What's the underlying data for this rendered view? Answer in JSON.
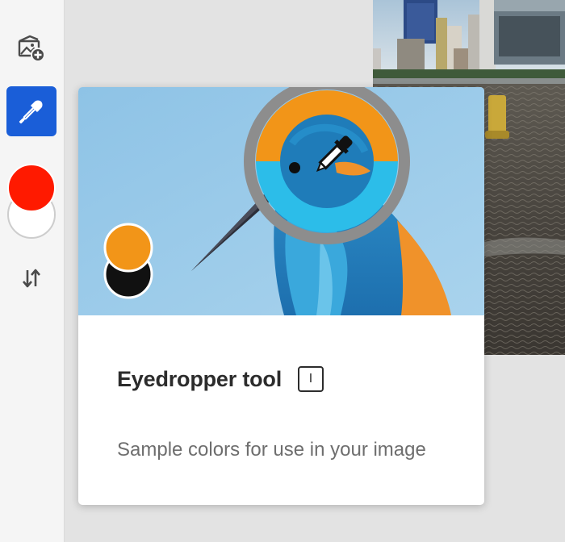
{
  "toolbar": {
    "tools": [
      {
        "name": "add-image",
        "icon": "image-add-icon",
        "active": false
      },
      {
        "name": "eyedropper",
        "icon": "eyedropper-icon",
        "active": true
      }
    ],
    "foreground_color": "#ff1a00",
    "background_color": "#ffffff",
    "swap_icon": "swap-arrows-icon",
    "accent_color": "#1a5ed8"
  },
  "tooltip": {
    "title": "Eyedropper tool",
    "shortcut": "I",
    "description": "Sample colors for use in your image",
    "illustration": {
      "sampled_primary_color": "#f29518",
      "sampled_secondary_color": "#111111",
      "loupe_top_color": "#f29518",
      "loupe_bottom_color": "#2cbde9"
    }
  }
}
